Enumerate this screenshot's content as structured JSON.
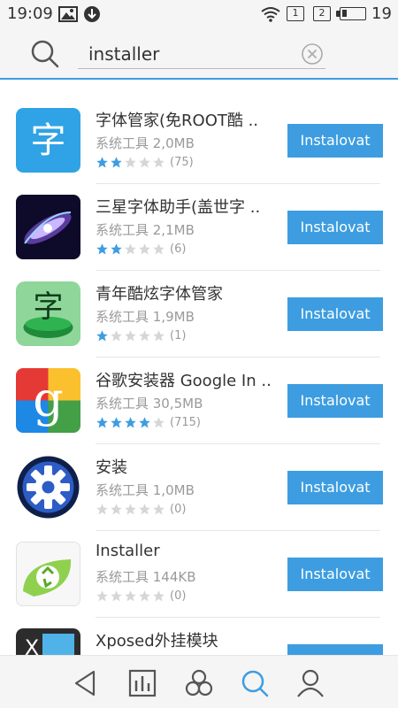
{
  "status_bar": {
    "time": "19:09",
    "sim1": "1",
    "sim2": "2",
    "battery_level": "19"
  },
  "search": {
    "query": "installer",
    "placeholder": ""
  },
  "colors": {
    "accent": "#3d9de0",
    "star_filled": "#3d9de0",
    "star_empty": "#d6d6d6"
  },
  "apps": [
    {
      "name": "字体管家(免ROOT酷 ..",
      "meta": "系统工具 2,0MB",
      "rating_stars": 2,
      "rating_count": "(75)",
      "button": "Instalovat",
      "icon": "zi-blue-icon"
    },
    {
      "name": "三星字体助手(盖世字 ..",
      "meta": "系统工具 2,1MB",
      "rating_stars": 2,
      "rating_count": "(6)",
      "button": "Instalovat",
      "icon": "galaxy-icon"
    },
    {
      "name": "青年酷炫字体管家",
      "meta": "系统工具 1,9MB",
      "rating_stars": 1,
      "rating_count": "(1)",
      "button": "Instalovat",
      "icon": "zi-green-icon"
    },
    {
      "name": "谷歌安装器 Google In ..",
      "meta": "系统工具 30,5MB",
      "rating_stars": 4,
      "rating_count": "(715)",
      "button": "Instalovat",
      "icon": "google-g-icon"
    },
    {
      "name": "安装",
      "meta": "系统工具 1,0MB",
      "rating_stars": 0,
      "rating_count": "(0)",
      "button": "Instalovat",
      "icon": "gear-icon"
    },
    {
      "name": "Installer",
      "meta": "系统工具 144KB",
      "rating_stars": 0,
      "rating_count": "(0)",
      "button": "Instalovat",
      "icon": "recycle-leaf-icon"
    },
    {
      "name": "Xposed外挂模块",
      "meta": "",
      "rating_stars": 0,
      "rating_count": "",
      "button": "Instalovat",
      "icon": "xposed-icon"
    }
  ],
  "bottom_nav": [
    "back-icon",
    "ranking-icon",
    "categories-icon",
    "search-icon",
    "profile-icon"
  ]
}
